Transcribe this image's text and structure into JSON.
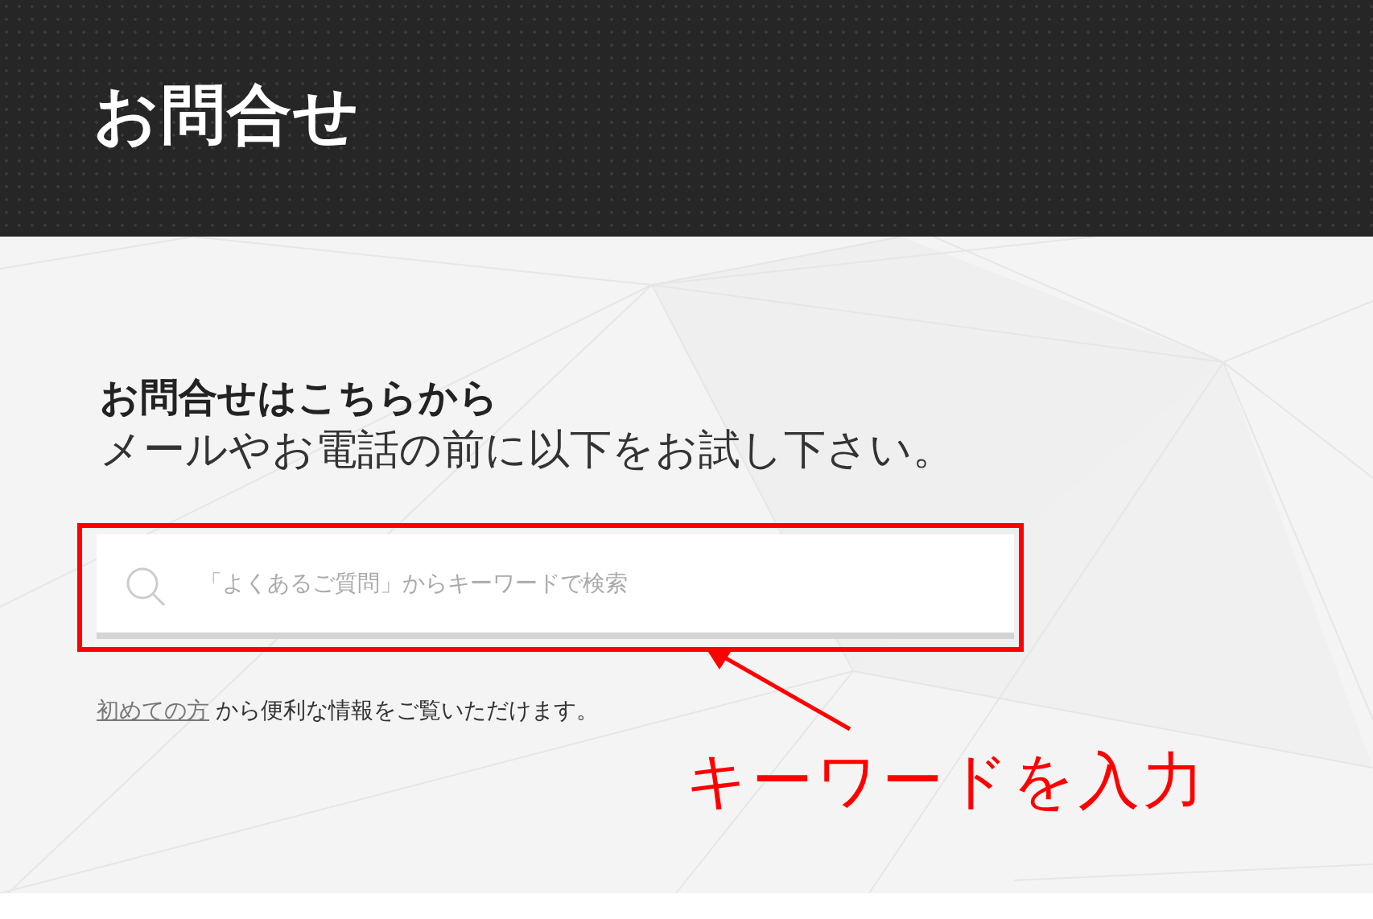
{
  "header": {
    "title": "お問合せ"
  },
  "intro": {
    "heading": "お問合せはこちらから",
    "subheading": "メールやお電話の前に以下をお試し下さい。"
  },
  "search": {
    "placeholder": "「よくあるご質問」からキーワードで検索"
  },
  "help": {
    "link": "初めての方",
    "text": "から便利な情報をご覧いただけます。"
  },
  "annotation": {
    "label": "キーワードを入力"
  }
}
